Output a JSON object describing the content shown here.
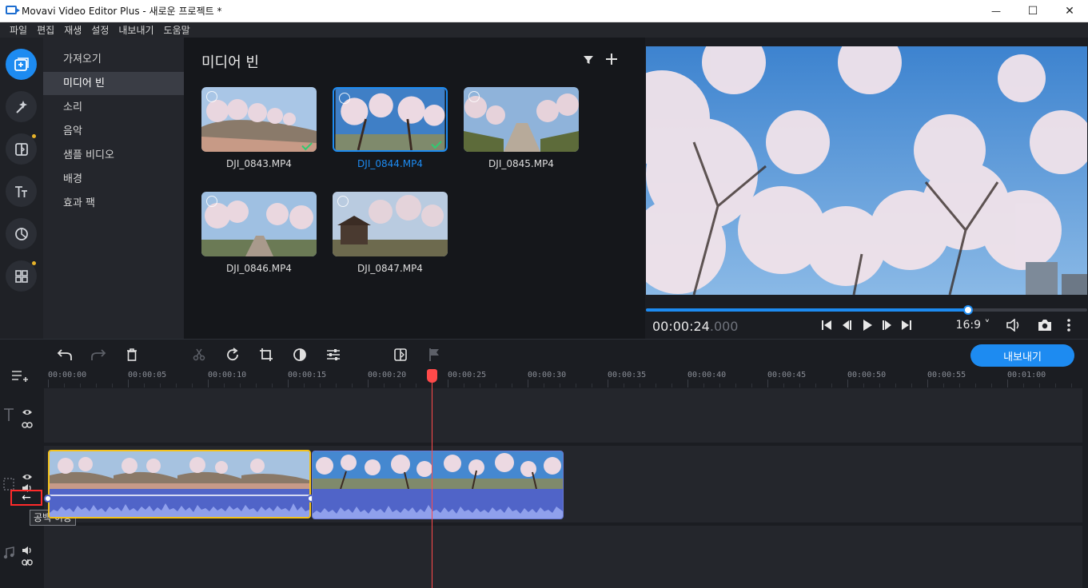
{
  "window": {
    "title": "Movavi Video Editor Plus - 새로운 프로젝트 *",
    "minimize": "—",
    "maximize": "☐",
    "close": "✕"
  },
  "menu": [
    "파일",
    "편집",
    "재생",
    "설정",
    "내보내기",
    "도움말"
  ],
  "rail": [
    {
      "icon": "import-media-icon",
      "active": true,
      "dot": false
    },
    {
      "icon": "magic-wand-icon",
      "active": false,
      "dot": false
    },
    {
      "icon": "transitions-icon",
      "active": false,
      "dot": true
    },
    {
      "icon": "titles-icon",
      "active": false,
      "dot": false
    },
    {
      "icon": "stickers-icon",
      "active": false,
      "dot": false
    },
    {
      "icon": "more-tools-icon",
      "active": false,
      "dot": true
    }
  ],
  "categories": [
    {
      "label": "가져오기",
      "active": false
    },
    {
      "label": "미디어 빈",
      "active": true
    },
    {
      "label": "소리",
      "active": false
    },
    {
      "label": "음악",
      "active": false
    },
    {
      "label": "샘플 비디오",
      "active": false
    },
    {
      "label": "배경",
      "active": false
    },
    {
      "label": "효과 팩",
      "active": false
    }
  ],
  "bin": {
    "title": "미디어 빈",
    "items": [
      {
        "name": "DJI_0843.MP4",
        "selected": false,
        "used": true
      },
      {
        "name": "DJI_0844.MP4",
        "selected": true,
        "used": true
      },
      {
        "name": "DJI_0845.MP4",
        "selected": false,
        "used": false
      },
      {
        "name": "DJI_0846.MP4",
        "selected": false,
        "used": false
      },
      {
        "name": "DJI_0847.MP4",
        "selected": false,
        "used": false
      }
    ]
  },
  "player": {
    "timecode_main": "00:00:24",
    "timecode_ms": ".000",
    "aspect": "16:9 ˅",
    "progress": 0.73
  },
  "export_label": "내보내기",
  "ruler": [
    "00:00:00",
    "00:00:05",
    "00:00:10",
    "00:00:15",
    "00:00:20",
    "00:00:25",
    "00:00:30",
    "00:00:35",
    "00:00:40",
    "00:00:45",
    "00:00:50",
    "00:00:55",
    "00:01:00"
  ],
  "tooltip": "공백 허용",
  "colors": {
    "accent": "#1d8bf1",
    "clip_selected_border": "#f4c21b",
    "audio_wave": "#5a6fd8",
    "playhead": "#ff4a4a"
  }
}
